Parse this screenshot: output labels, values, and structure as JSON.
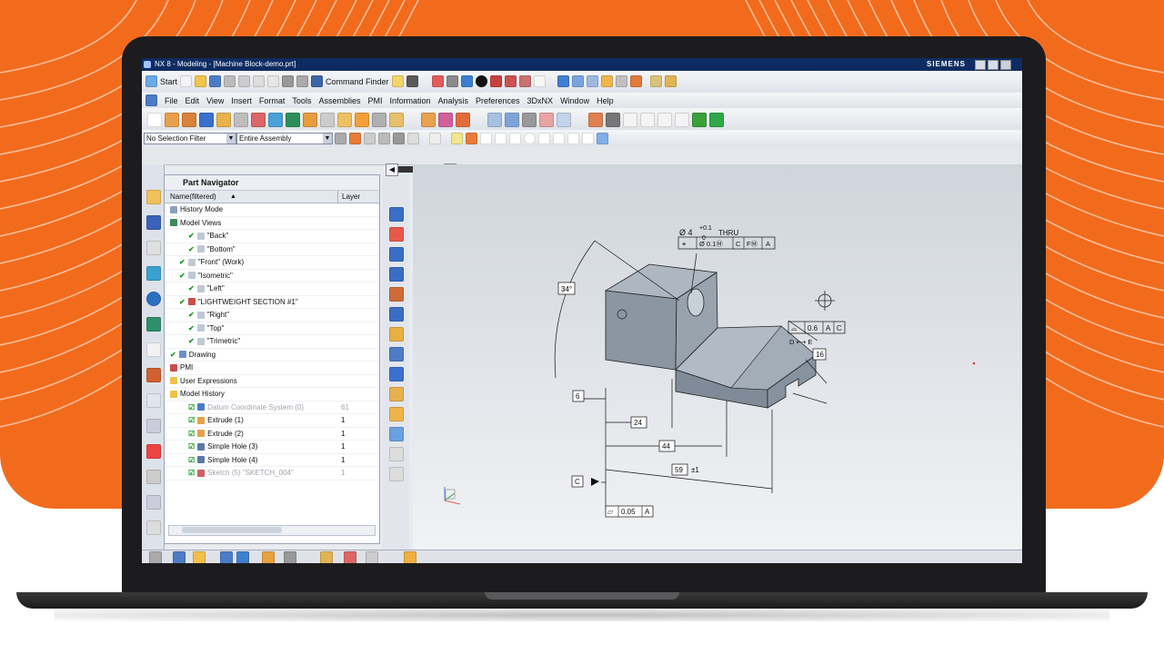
{
  "window": {
    "title": "NX 8 - Modeling - [Machine Block-demo.prt]",
    "brand": "SIEMENS"
  },
  "toolbar": {
    "start_label": "Start",
    "command_finder_label": "Command Finder"
  },
  "menubar": {
    "items": [
      "File",
      "Edit",
      "View",
      "Insert",
      "Format",
      "Tools",
      "Assemblies",
      "PMI",
      "Information",
      "Analysis",
      "Preferences",
      "3DxNX",
      "Window",
      "Help"
    ]
  },
  "selection": {
    "filter": "No Selection Filter",
    "scope": "Entire Assembly"
  },
  "navigator": {
    "title": "Part Navigator",
    "col_name": "Name(filtered)",
    "col_layer": "Layer",
    "rows": [
      {
        "text": "History Mode",
        "layer": "",
        "indent": 0,
        "icon": "clock-icon",
        "check": "",
        "dim": false
      },
      {
        "text": "Model Views",
        "layer": "",
        "indent": 0,
        "icon": "views-icon",
        "check": "",
        "dim": false
      },
      {
        "text": "\"Back\"",
        "layer": "",
        "indent": 2,
        "icon": "view-icon",
        "check": "✔",
        "dim": false
      },
      {
        "text": "\"Bottom\"",
        "layer": "",
        "indent": 2,
        "icon": "view-icon",
        "check": "✔",
        "dim": false
      },
      {
        "text": "\"Front\" (Work)",
        "layer": "",
        "indent": 1,
        "icon": "view-icon",
        "check": "✔",
        "dim": false
      },
      {
        "text": "\"Isometric\"",
        "layer": "",
        "indent": 1,
        "icon": "view-icon",
        "check": "✔",
        "dim": false
      },
      {
        "text": "\"Left\"",
        "layer": "",
        "indent": 2,
        "icon": "view-icon",
        "check": "✔",
        "dim": false
      },
      {
        "text": "\"LIGHTWEIGHT SECTION #1\"",
        "layer": "",
        "indent": 1,
        "icon": "section-icon",
        "check": "✔",
        "dim": false
      },
      {
        "text": "\"Right\"",
        "layer": "",
        "indent": 2,
        "icon": "view-icon",
        "check": "✔",
        "dim": false
      },
      {
        "text": "\"Top\"",
        "layer": "",
        "indent": 2,
        "icon": "view-icon",
        "check": "✔",
        "dim": false
      },
      {
        "text": "\"Trimetric\"",
        "layer": "",
        "indent": 2,
        "icon": "view-icon",
        "check": "✔",
        "dim": false
      },
      {
        "text": "Drawing",
        "layer": "",
        "indent": 0,
        "icon": "drawing-icon",
        "check": "✔",
        "dim": false
      },
      {
        "text": "PMI",
        "layer": "",
        "indent": 0,
        "icon": "pmi-icon",
        "check": "",
        "dim": false
      },
      {
        "text": "User Expressions",
        "layer": "",
        "indent": 0,
        "icon": "folder-icon",
        "check": "",
        "dim": false
      },
      {
        "text": "Model History",
        "layer": "",
        "indent": 0,
        "icon": "folder-icon",
        "check": "",
        "dim": false
      },
      {
        "text": "Datum Coordinate System (0)",
        "layer": "61",
        "indent": 2,
        "icon": "datum-icon",
        "check": "☑",
        "dim": true
      },
      {
        "text": "Extrude (1)",
        "layer": "1",
        "indent": 2,
        "icon": "extrude-icon",
        "check": "☑",
        "dim": false
      },
      {
        "text": "Extrude (2)",
        "layer": "1",
        "indent": 2,
        "icon": "extrude-icon",
        "check": "☑",
        "dim": false
      },
      {
        "text": "Simple Hole (3)",
        "layer": "1",
        "indent": 2,
        "icon": "hole-icon",
        "check": "☑",
        "dim": false
      },
      {
        "text": "Simple Hole (4)",
        "layer": "1",
        "indent": 2,
        "icon": "hole-icon",
        "check": "☑",
        "dim": false
      },
      {
        "text": "Sketch (5) \"SKETCH_004\"",
        "layer": "1",
        "indent": 2,
        "icon": "sketch-icon",
        "check": "☑",
        "dim": true
      }
    ]
  },
  "pmi": {
    "hole_dia": "Ø 4",
    "hole_tol_upper": "+0.1",
    "hole_tol_lower": "0",
    "hole_thru": "THRU",
    "fcf_position": [
      "⌖",
      "Ø 0.1Ⓜ",
      "C",
      "FⓂ",
      "A"
    ],
    "angle": "34°",
    "profile_fcf": [
      "⌓",
      "0.6",
      "A",
      "C"
    ],
    "profile_between": "D ⟷ E",
    "dim_6": "6",
    "dim_24": "24",
    "dim_44": "44",
    "dim_59": "59",
    "dim_59_tol": "±1",
    "dim_16": "16",
    "datum_c": "C",
    "flatness_fcf": [
      "⏥",
      "0.05",
      "A"
    ]
  },
  "colors": {
    "orange": "#f26b1d",
    "titlebar": "#0f2c62",
    "model_face": "#8a96a2"
  }
}
